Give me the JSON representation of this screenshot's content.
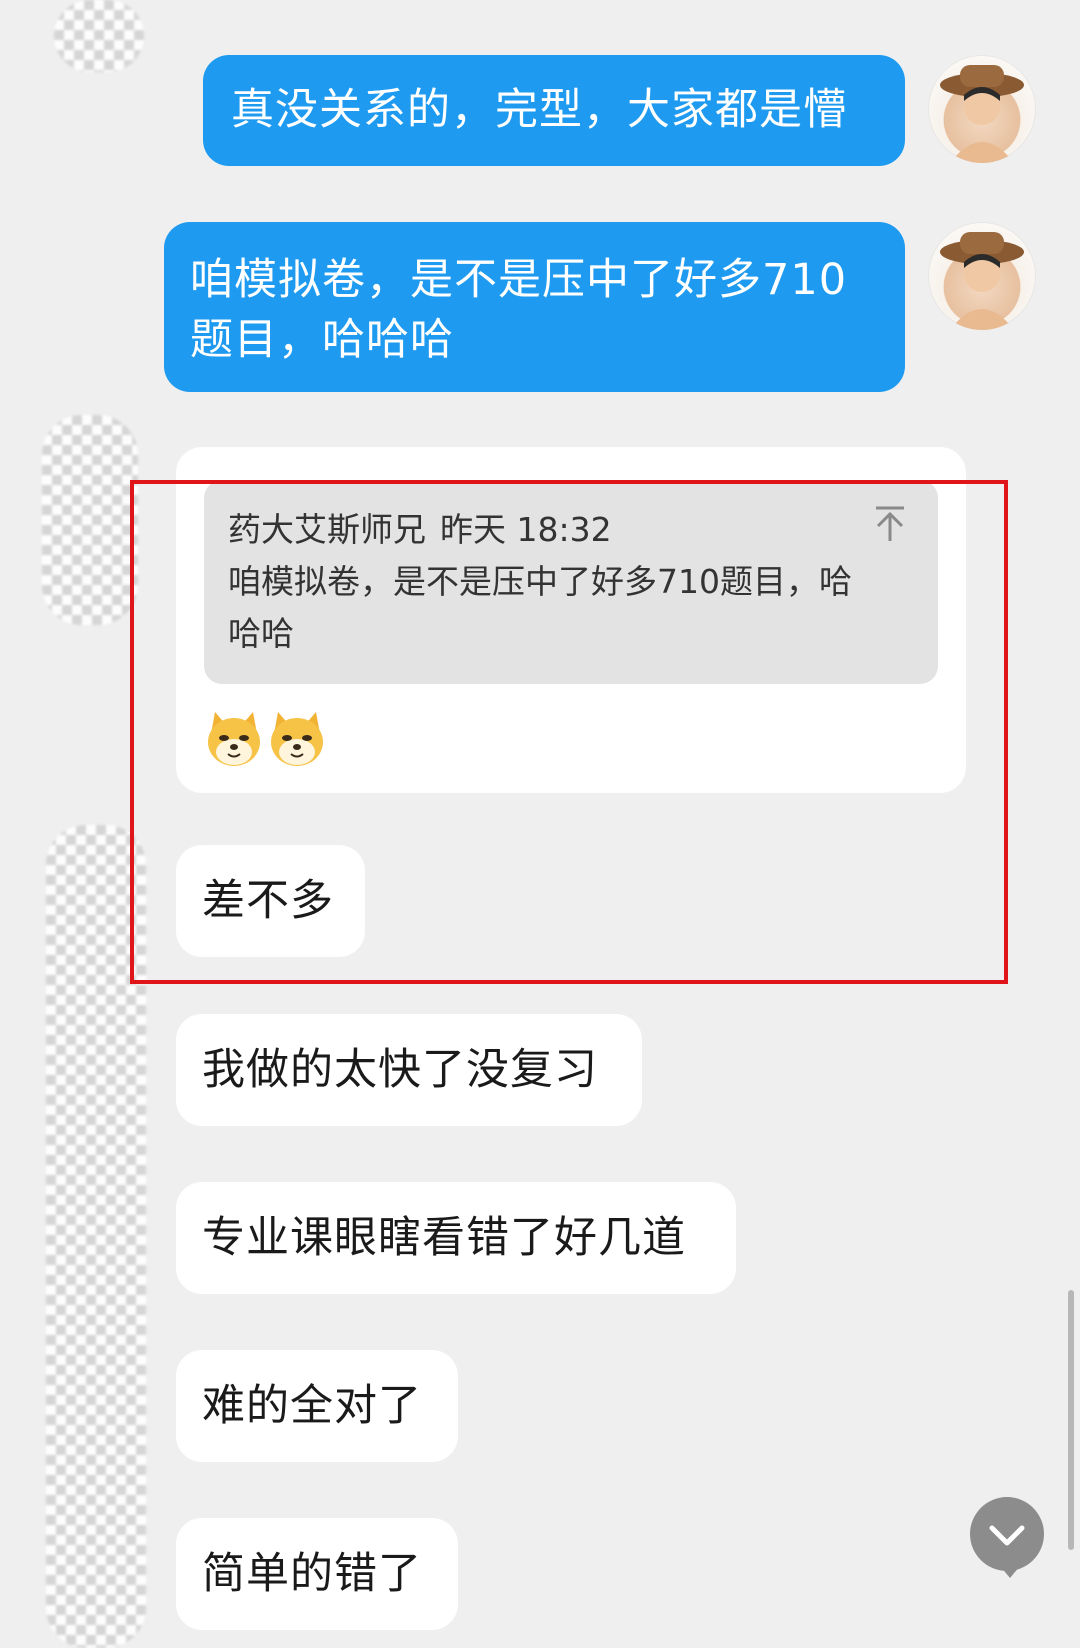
{
  "messages": [
    {
      "side": "me",
      "text": "真没关系的，完型，大家都是懵"
    },
    {
      "side": "me",
      "text": "咱模拟卷，是不是压中了好多710题目，哈哈哈",
      "lines": [
        "咱模拟卷，是不是压中了好多710",
        "题目，哈哈哈"
      ]
    },
    {
      "side": "other",
      "quote": {
        "sender": "药大艾斯师兄",
        "time": "昨天 18:32",
        "lines": [
          "咱模拟卷，是不是压中了好多710题目，哈",
          "哈哈"
        ]
      },
      "emoji": [
        "doge-emoji",
        "doge-emoji"
      ]
    },
    {
      "side": "other",
      "text": "差不多"
    },
    {
      "side": "other",
      "text": "我做的太快了没复习"
    },
    {
      "side": "other",
      "text": "专业课眼瞎看错了好几道"
    },
    {
      "side": "other",
      "text": "难的全对了"
    },
    {
      "side": "other",
      "text": "简单的错了"
    }
  ],
  "icons": {
    "quote_jump": "arrow-up-to-top-icon",
    "scroll_down": "chevron-down-icon"
  },
  "colors": {
    "my_bubble": "#1e9bf0",
    "highlight_box": "#e0151a"
  }
}
